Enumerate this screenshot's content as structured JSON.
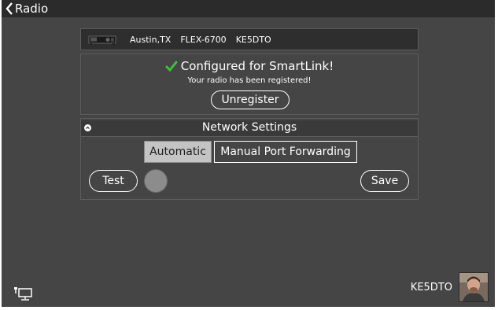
{
  "header": {
    "back_label": "Radio"
  },
  "radio": {
    "location": "Austin,TX",
    "model": "FLEX-6700",
    "callsign": "KE5DTO"
  },
  "smartlink": {
    "status_title": "Configured for SmartLink!",
    "status_subtitle": "Your radio has been registered!",
    "unregister_label": "Unregister"
  },
  "network": {
    "title": "Network Settings",
    "modes": [
      "Automatic",
      "Manual Port Forwarding"
    ],
    "selected_mode": "Automatic",
    "test_label": "Test",
    "save_label": "Save"
  },
  "user": {
    "name": "KE5DTO"
  },
  "colors": {
    "background": "#454545",
    "topbar": "#2b2b2b",
    "check": "#3fbf3f",
    "selected_segment": "#c4c4c4",
    "status_dot": "#8c8c8c"
  }
}
